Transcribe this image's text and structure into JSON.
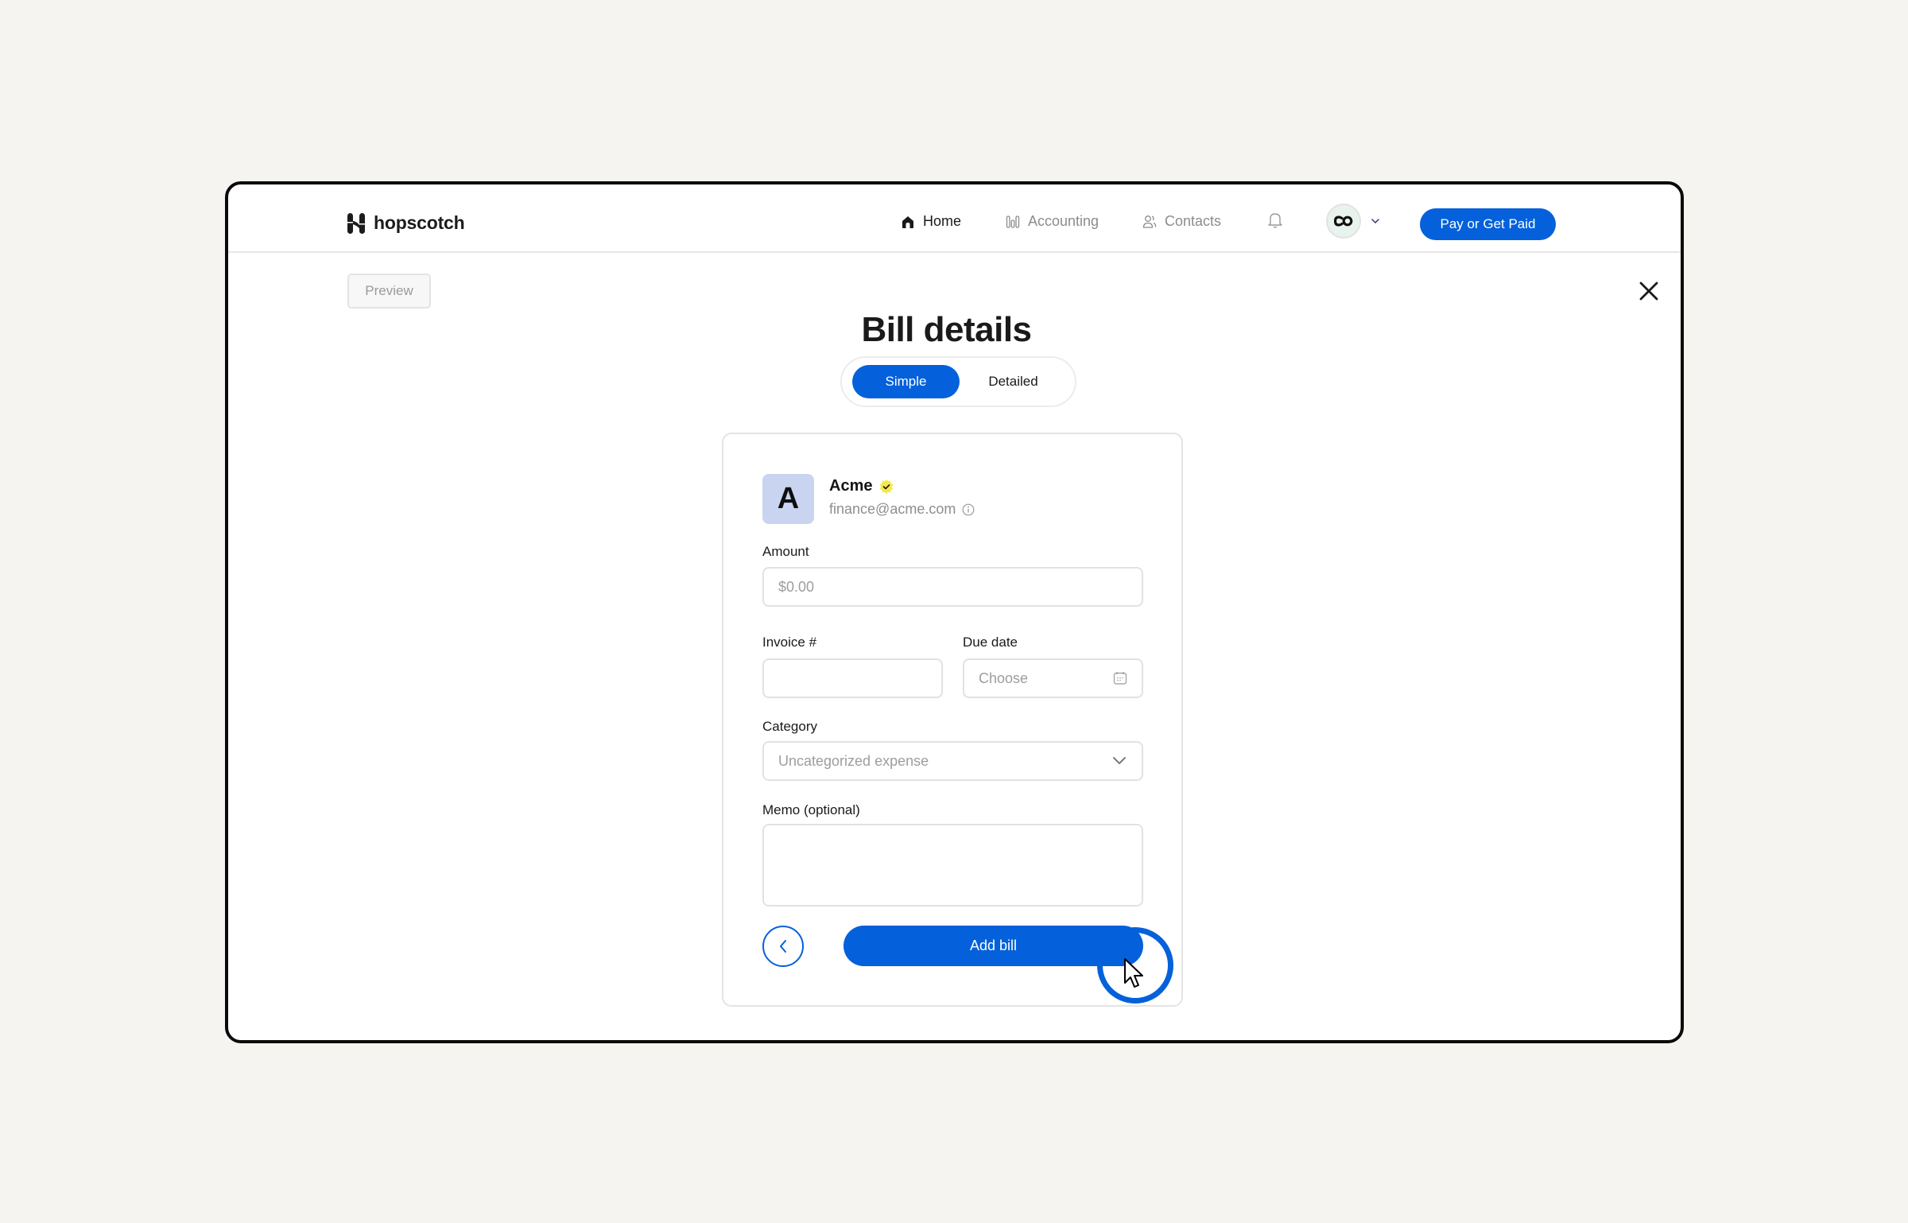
{
  "app": {
    "brand": "hopscotch",
    "colors": {
      "accent": "#0461db",
      "background": "#f5f4f0",
      "avatar_bg": "#c9d5f0",
      "verified_badge": "#f5e94a",
      "org_avatar_bg": "#e9f3ee"
    }
  },
  "nav": {
    "items": [
      {
        "label": "Home",
        "icon": "home-icon",
        "active": true
      },
      {
        "label": "Accounting",
        "icon": "chart-bars-icon",
        "active": false
      },
      {
        "label": "Contacts",
        "icon": "users-icon",
        "active": false
      }
    ],
    "notifications_icon": "bell-icon",
    "org_initials": "CO",
    "org_dropdown_icon": "chevron-down-icon",
    "cta_label": "Pay or Get Paid"
  },
  "toolbar": {
    "preview_label": "Preview",
    "close_icon": "close-icon"
  },
  "page": {
    "title": "Bill details",
    "view_modes": [
      {
        "label": "Simple",
        "active": true
      },
      {
        "label": "Detailed",
        "active": false
      }
    ]
  },
  "vendor": {
    "initial": "A",
    "name": "Acme",
    "verified": true,
    "email": "finance@acme.com",
    "info_icon": "info-icon"
  },
  "form": {
    "amount": {
      "label": "Amount",
      "placeholder": "$0.00",
      "value": ""
    },
    "invoice": {
      "label": "Invoice #",
      "placeholder": "",
      "value": ""
    },
    "due_date": {
      "label": "Due date",
      "placeholder": "Choose",
      "value": ""
    },
    "category": {
      "label": "Category",
      "selected": "Uncategorized expense"
    },
    "memo": {
      "label": "Memo (optional)",
      "placeholder": "",
      "value": ""
    },
    "back_icon": "chevron-left-icon",
    "submit_label": "Add bill"
  }
}
